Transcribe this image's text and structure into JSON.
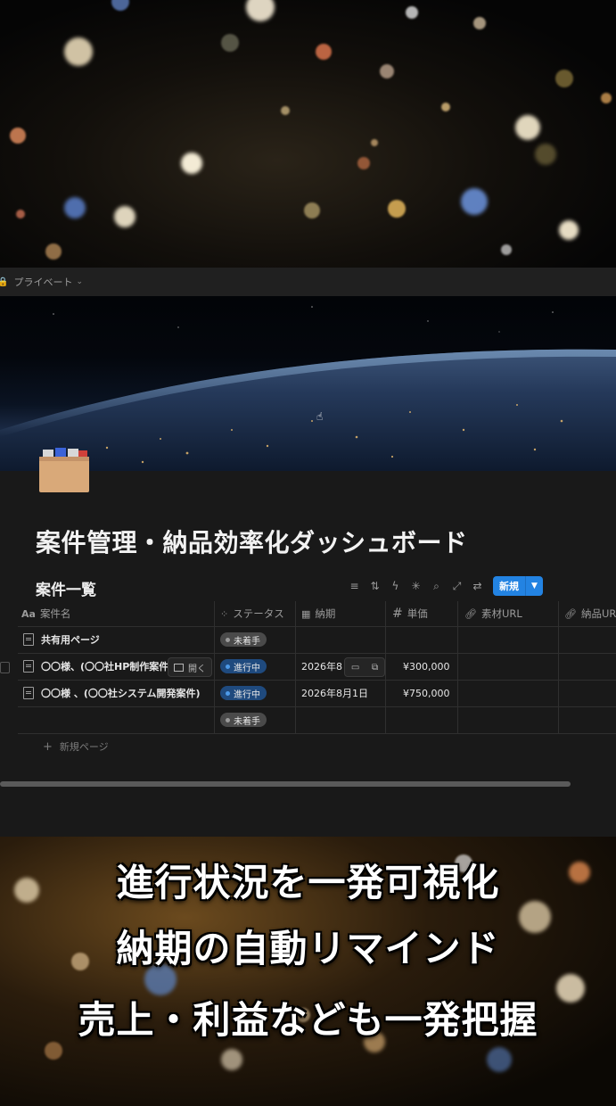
{
  "breadcrumb": {
    "label": "プライベート"
  },
  "page": {
    "title": "案件管理・納品効率化ダッシュボード"
  },
  "database": {
    "title": "案件一覧",
    "new_button": "新規",
    "columns": [
      {
        "label": "案件名",
        "icon": "Aa"
      },
      {
        "label": "ステータス",
        "icon": "status-icon"
      },
      {
        "label": "納期",
        "icon": "calendar-icon"
      },
      {
        "label": "単価",
        "icon": "#"
      },
      {
        "label": "素材URL",
        "icon": "link-icon"
      },
      {
        "label": "納品URL",
        "icon": "link-icon"
      }
    ],
    "rows": [
      {
        "name": "共有用ページ",
        "status": "未着手",
        "status_color": "#4a4a4a",
        "due": "",
        "price": ""
      },
      {
        "name": "〇〇様、(〇〇社HP制作案件",
        "status": "進行中",
        "status_color": "#1f4a7e",
        "due": "2026年8",
        "price": "¥300,000"
      },
      {
        "name": "〇〇様 、(〇〇社システム開発案件)",
        "status": "進行中",
        "status_color": "#1f4a7e",
        "due": "2026年8月1日",
        "price": "¥750,000"
      },
      {
        "name": "",
        "status": "未着手",
        "status_color": "#4a4a4a",
        "due": "",
        "price": ""
      }
    ],
    "open_button": "開く",
    "new_page": "新規ページ"
  },
  "captions": [
    "進行状況を一発可視化",
    "納期の自動リマインド",
    "売上・利益なども一発把握"
  ],
  "colors": {
    "accent": "#2383e2",
    "background": "#191919"
  }
}
